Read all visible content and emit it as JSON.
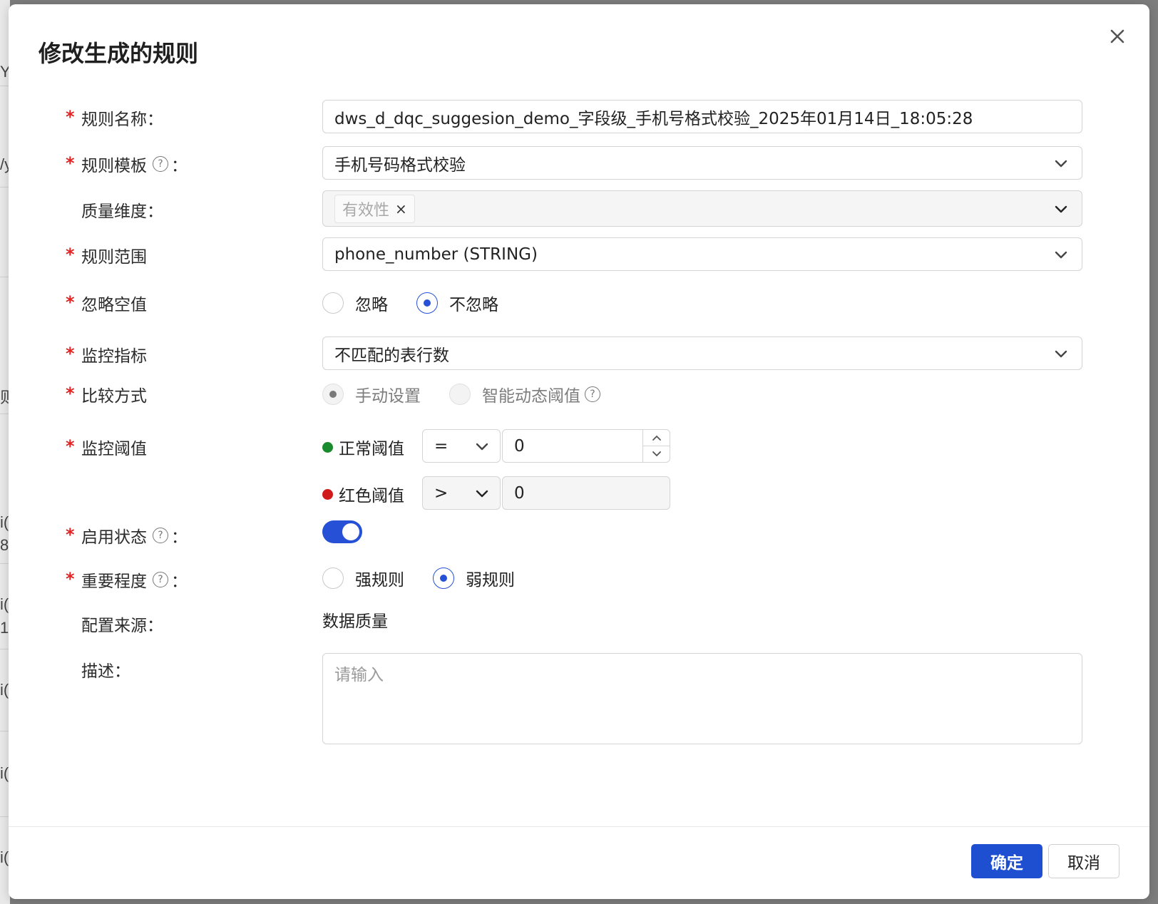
{
  "background": {
    "fragments": [
      "Y:",
      "/y",
      "则",
      "i(",
      "8",
      "i(",
      "1(",
      "i(",
      "i(",
      "i("
    ]
  },
  "modal": {
    "title": "修改生成的规则"
  },
  "form": {
    "rule_name": {
      "label": "规则名称：",
      "required": true,
      "value": "dws_d_dqc_suggesion_demo_字段级_手机号格式校验_2025年01月14日_18:05:28"
    },
    "rule_template": {
      "label": "规则模板",
      "colon": "：",
      "required": true,
      "value": "手机号码格式校验"
    },
    "quality_dimension": {
      "label": "质量维度：",
      "required": false,
      "tag": "有效性"
    },
    "rule_scope": {
      "label": "规则范围",
      "required": true,
      "value": "phone_number (STRING)"
    },
    "ignore_null": {
      "label": "忽略空值",
      "required": true,
      "options": [
        "忽略",
        "不忽略"
      ],
      "selected": "不忽略"
    },
    "monitor_metric": {
      "label": "监控指标",
      "required": true,
      "value": "不匹配的表行数"
    },
    "compare_mode": {
      "label": "比较方式",
      "required": true,
      "options": [
        "手动设置",
        "智能动态阈值"
      ],
      "selected": "手动设置"
    },
    "monitor_threshold": {
      "label": "监控阈值",
      "required": true,
      "normal": {
        "label": "正常阈值",
        "operator": "=",
        "value": "0",
        "dot_color": "#1a8a2e"
      },
      "red": {
        "label": "红色阈值",
        "operator": ">",
        "value": "0",
        "dot_color": "#d11a1a"
      }
    },
    "enabled": {
      "label": "启用状态",
      "colon": "：",
      "required": true,
      "on": true
    },
    "importance": {
      "label": "重要程度",
      "colon": "：",
      "required": true,
      "options": [
        "强规则",
        "弱规则"
      ],
      "selected": "弱规则"
    },
    "config_source": {
      "label": "配置来源：",
      "value": "数据质量"
    },
    "description": {
      "label": "描述：",
      "placeholder": "请输入"
    }
  },
  "footer": {
    "confirm_label": "确定",
    "cancel_label": "取消"
  },
  "colors": {
    "primary": "#1f4fd1",
    "required": "#e02424"
  }
}
